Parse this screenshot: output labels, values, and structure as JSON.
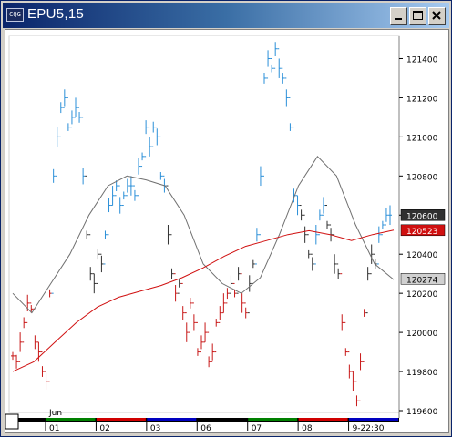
{
  "window": {
    "title": "EPU5,15",
    "icon_label": "CQG"
  },
  "chart_data": {
    "type": "bar",
    "title": "EPU5,15",
    "ylim": [
      119600,
      121500
    ],
    "y_ticks": [
      "121400",
      "121200",
      "121000",
      "120800",
      "120600",
      "120400",
      "120200",
      "120000",
      "119800",
      "119600"
    ],
    "y_tick_values": [
      121400,
      121200,
      121000,
      120800,
      120600,
      120400,
      120200,
      120000,
      119800,
      119600
    ],
    "x_labels": [
      "01",
      "02",
      "03",
      "06",
      "07",
      "08",
      "9-22:30"
    ],
    "x_top_label": "Jun",
    "colors": {
      "up": "#2a8fd8",
      "down": "#c81818",
      "neutral": "#303030",
      "ma_fast": "#707070",
      "ma_slow": "#d01010"
    },
    "last_price_label": "120600",
    "ma_slow_label": "120523",
    "ma_fast_label": "120274",
    "series": [
      {
        "name": "price_bars",
        "values": [
          119880,
          119850,
          119950,
          120050,
          120150,
          120120,
          119950,
          119900,
          119800,
          119750,
          120200,
          120800,
          121000,
          121150,
          121200,
          121050,
          121100,
          121150,
          121100,
          120800,
          120500,
          120300,
          120250,
          120400,
          120350,
          120500,
          120650,
          120700,
          120750,
          120650,
          120700,
          120750,
          120750,
          120700,
          120850,
          120900,
          121050,
          120950,
          121050,
          121000,
          120800,
          120750,
          120500,
          120300,
          120200,
          120250,
          120100,
          120000,
          120150,
          120050,
          119900,
          119950,
          120000,
          119850,
          119900,
          120050,
          120100,
          120150,
          120200,
          120250,
          120200,
          120300,
          120150,
          120100,
          120250,
          120350,
          120500,
          120800,
          121300,
          121400,
          121350,
          121450,
          121350,
          121300,
          121200,
          121050,
          120700,
          120650,
          120600,
          120500,
          120400,
          120350,
          120500,
          120600,
          120650,
          120550,
          120500,
          120350,
          120300,
          120050,
          119900,
          119800,
          119750,
          119650,
          119850,
          120100,
          120300,
          120400,
          120350,
          120500,
          120550,
          120600,
          120600
        ]
      },
      {
        "name": "MA fast",
        "values": [
          120200,
          120100,
          120250,
          120400,
          120600,
          120750,
          120800,
          120780,
          120750,
          120600,
          120350,
          120250,
          120200,
          120280,
          120500,
          120750,
          120900,
          120800,
          120550,
          120350,
          120270
        ]
      },
      {
        "name": "MA slow",
        "values": [
          119800,
          119850,
          119950,
          120050,
          120130,
          120180,
          120210,
          120240,
          120280,
          120330,
          120390,
          120440,
          120470,
          120500,
          120520,
          120500,
          120470,
          120500,
          120523
        ]
      }
    ]
  }
}
